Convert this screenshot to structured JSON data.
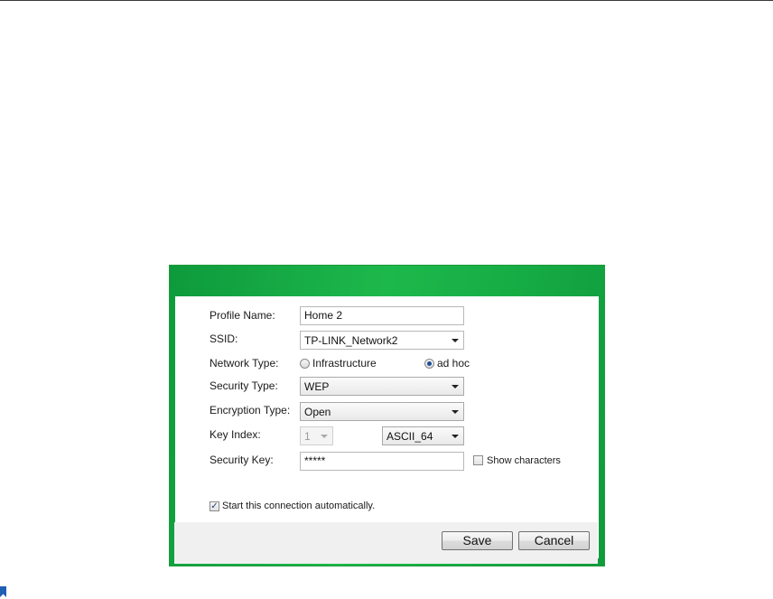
{
  "form": {
    "profile_name": {
      "label": "Profile Name:",
      "value": "Home 2"
    },
    "ssid": {
      "label": "SSID:",
      "value": "TP-LINK_Network2"
    },
    "network_type": {
      "label": "Network Type:",
      "options": [
        {
          "label": "Infrastructure",
          "selected": false
        },
        {
          "label": "ad hoc",
          "selected": true
        }
      ]
    },
    "security_type": {
      "label": "Security Type:",
      "value": "WEP"
    },
    "encryption_type": {
      "label": "Encryption Type:",
      "value": "Open"
    },
    "key_index": {
      "label": "Key Index:",
      "value": "1",
      "format": "ASCII_64"
    },
    "security_key": {
      "label": "Security Key:",
      "value": "*****",
      "show_characters_label": "Show characters",
      "show_characters": false
    },
    "auto_connect": {
      "label": "Start this connection automatically.",
      "checked": true
    }
  },
  "buttons": {
    "save": "Save",
    "cancel": "Cancel"
  },
  "colors": {
    "title_green": "#1db84c",
    "border_green": "#1e9a3a",
    "radio_selected": "#1c4f9c"
  }
}
